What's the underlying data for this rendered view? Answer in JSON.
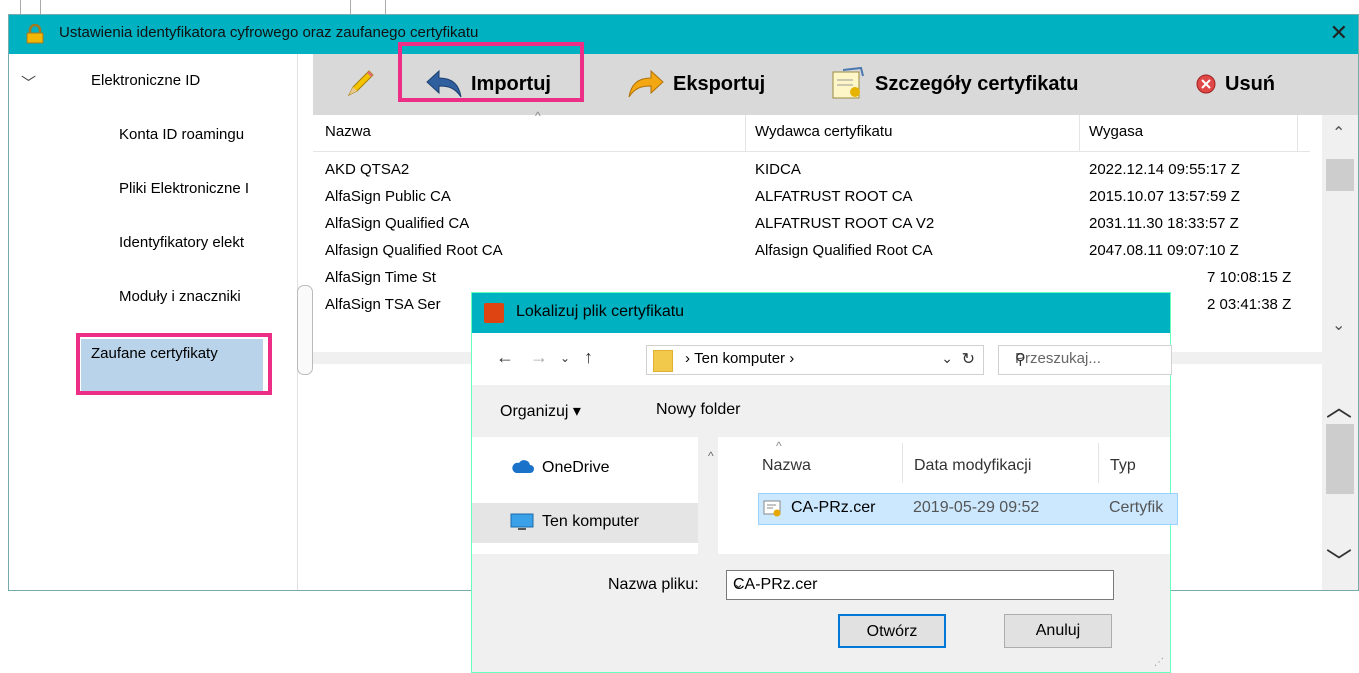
{
  "window": {
    "title": "Ustawienia identyfikatora cyfrowego oraz zaufanego certyfikatu",
    "close_glyph": "✕"
  },
  "tree": {
    "root_label": "Elektroniczne ID",
    "items": [
      {
        "label": "Konta ID roamingu"
      },
      {
        "label": "Pliki Elektroniczne I"
      },
      {
        "label": "Identyfikatory elekt"
      },
      {
        "label": "Moduły i znaczniki"
      }
    ],
    "selected_label": "Zaufane certyfikaty"
  },
  "toolbar": {
    "import_label": "Importuj",
    "export_label": "Eksportuj",
    "details_label": "Szczegóły certyfikatu",
    "delete_label": "Usuń"
  },
  "table": {
    "headers": {
      "name": "Nazwa",
      "issuer": "Wydawca certyfikatu",
      "expires": "Wygasa"
    },
    "rows": [
      {
        "name": "AKD QTSA2",
        "issuer": "KIDCA",
        "expires": "2022.12.14 09:55:17 Z"
      },
      {
        "name": "AlfaSign Public CA",
        "issuer": "ALFATRUST ROOT CA",
        "expires": "2015.10.07 13:57:59 Z"
      },
      {
        "name": "AlfaSign Qualified CA",
        "issuer": "ALFATRUST ROOT CA V2",
        "expires": "2031.11.30 18:33:57 Z"
      },
      {
        "name": "Alfasign Qualified Root CA",
        "issuer": "Alfasign Qualified Root CA",
        "expires": "2047.08.11 09:07:10 Z"
      },
      {
        "name": "AlfaSign Time St",
        "issuer": "",
        "expires": "7 10:08:15 Z"
      },
      {
        "name": "AlfaSign TSA Ser",
        "issuer": "",
        "expires": "2 03:41:38 Z"
      }
    ]
  },
  "dialog": {
    "title": "Lokalizuj plik certyfikatu",
    "breadcrumb": "Ten komputer",
    "search_placeholder": "Przeszukaj...",
    "organize_label": "Organizuj ▾",
    "new_folder_label": "Nowy folder",
    "nav_items": {
      "onedrive": "OneDrive",
      "this_pc": "Ten komputer"
    },
    "columns": {
      "name": "Nazwa",
      "date": "Data modyfikacji",
      "type": "Typ"
    },
    "file": {
      "name": "CA-PRz.cer",
      "date": "2019-05-29 09:52",
      "type": "Certyfik"
    },
    "filename_label": "Nazwa pliku:",
    "filename_value": "CA-PRz.cer",
    "open_label": "Otwórz",
    "cancel_label": "Anuluj"
  },
  "colors": {
    "titlebar": "#00b1c1",
    "highlight": "#ec2e86",
    "selection": "#b8d3ea"
  }
}
